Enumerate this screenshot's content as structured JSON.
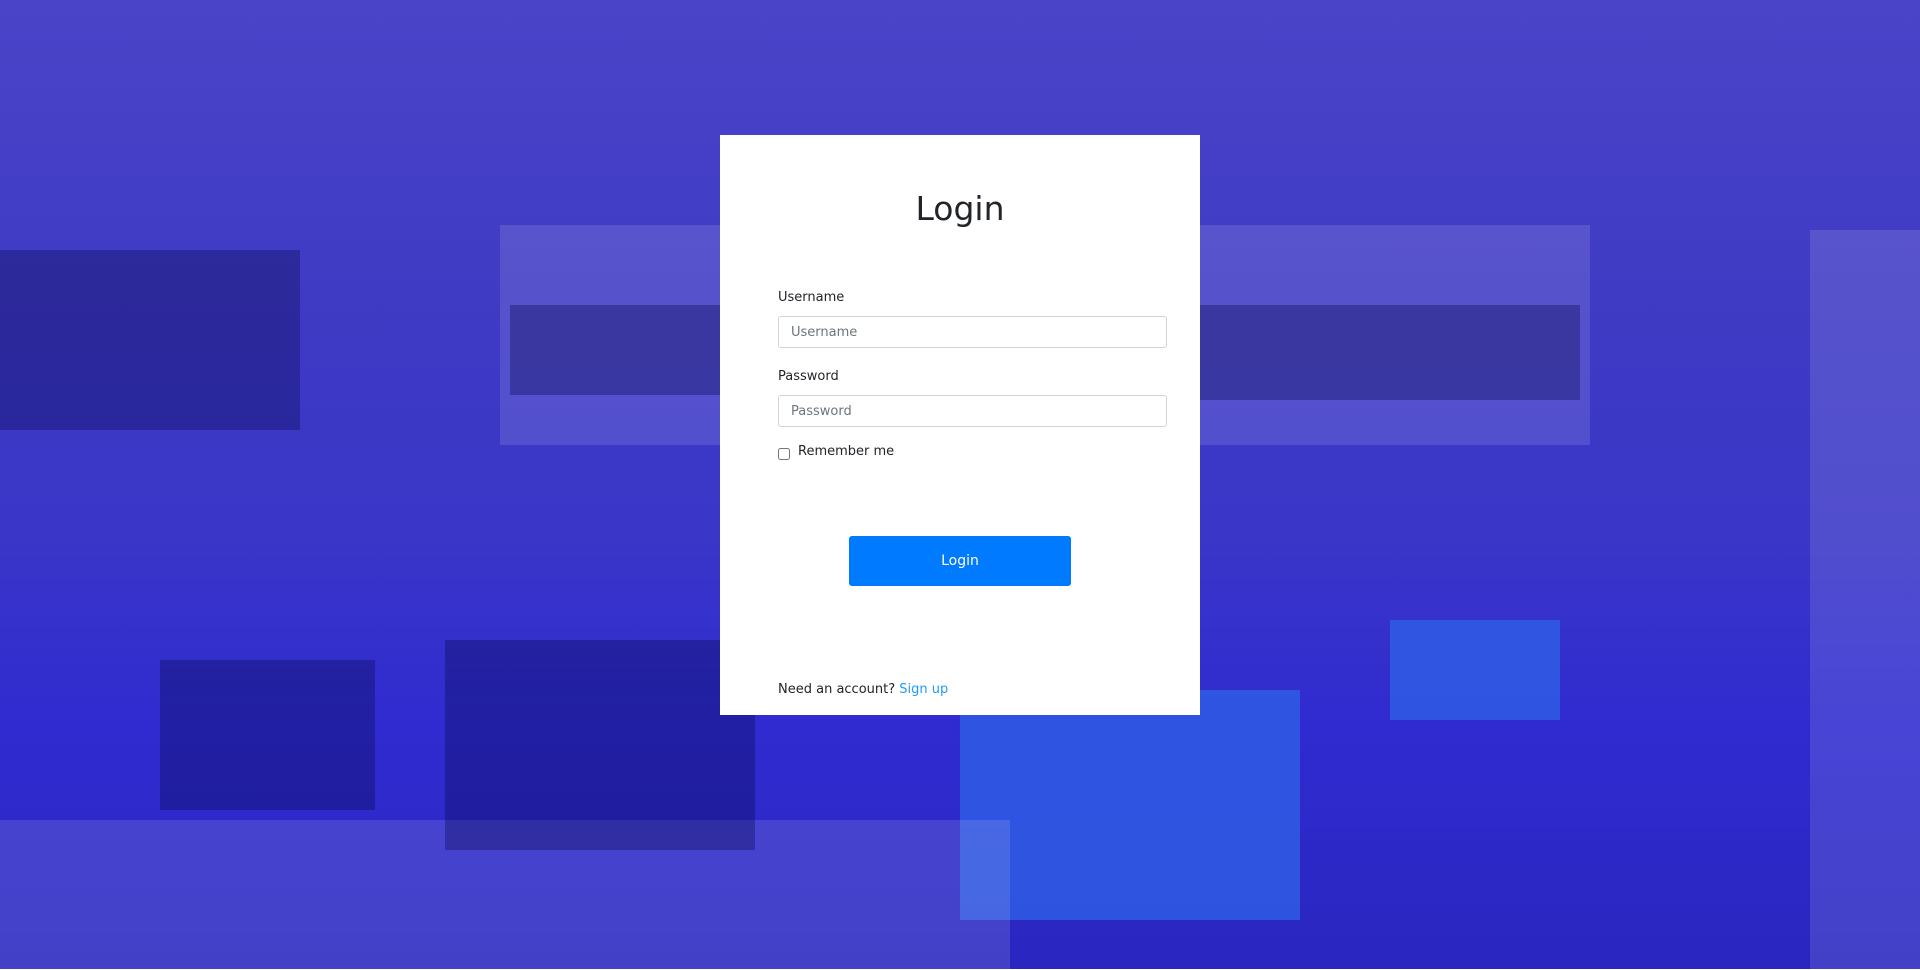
{
  "login": {
    "title": "Login",
    "username_label": "Username",
    "username_placeholder": "Username",
    "password_label": "Password",
    "password_placeholder": "Password",
    "remember_label": "Remember me",
    "remember_checked": false,
    "submit_label": "Login",
    "footer_text": "Need an account?",
    "signup_link": "Sign up"
  },
  "colors": {
    "primary": "#007bff",
    "link": "#1e9bff",
    "overlay": "#3f3bc4"
  }
}
